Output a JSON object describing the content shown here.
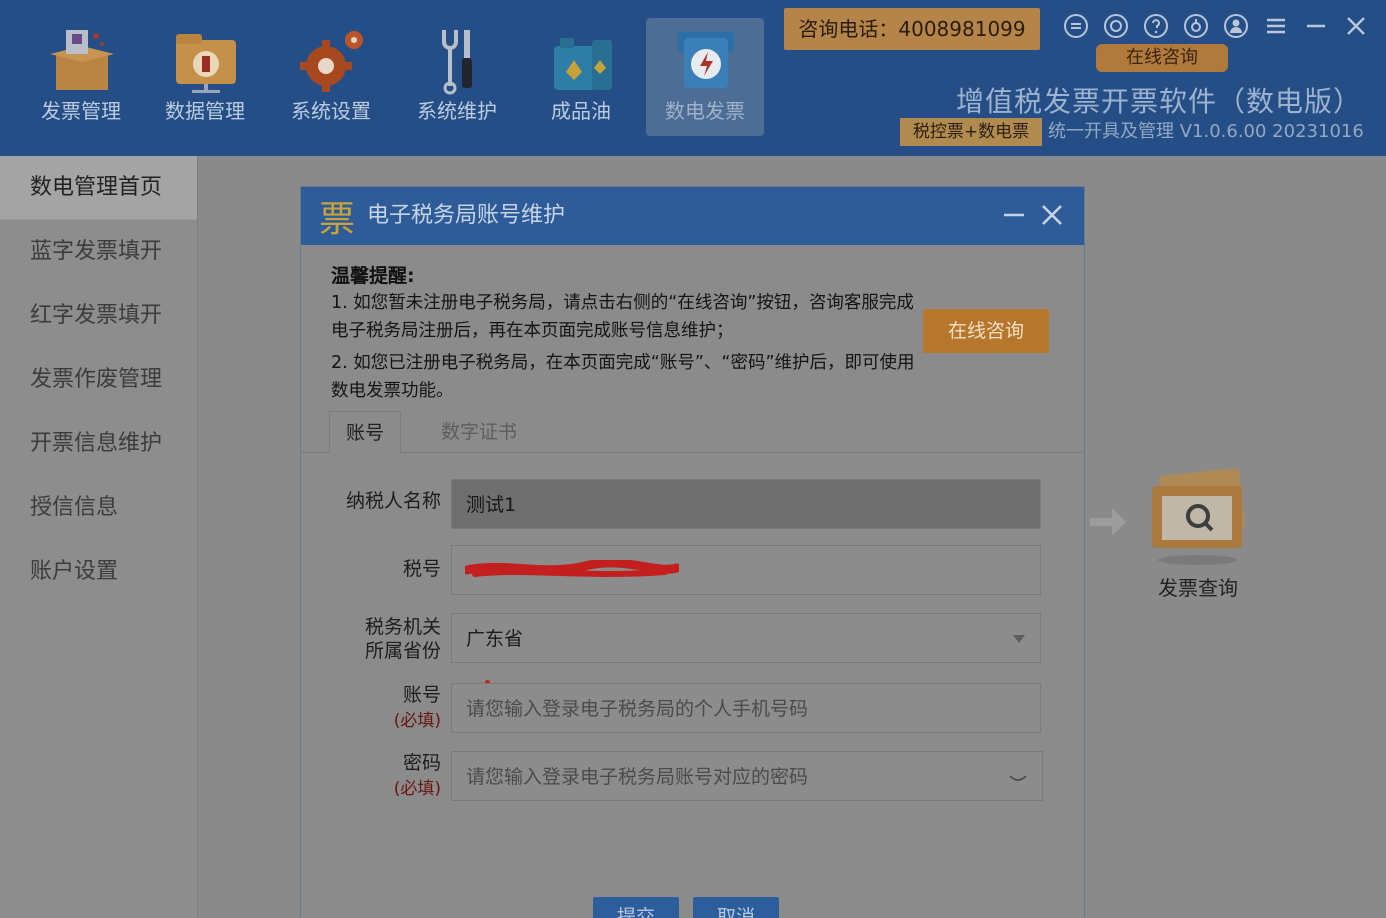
{
  "nav": [
    {
      "label": "发票管理",
      "icon": "invoice-box-icon"
    },
    {
      "label": "数据管理",
      "icon": "data-folder-icon"
    },
    {
      "label": "系统设置",
      "icon": "gear-icon"
    },
    {
      "label": "系统维护",
      "icon": "wrench-screwdriver-icon"
    },
    {
      "label": "成品油",
      "icon": "oil-can-icon"
    },
    {
      "label": "数电发票",
      "icon": "digital-invoice-icon"
    }
  ],
  "header": {
    "hotline": "咨询电话：4008981099",
    "consult_top": "在线咨询",
    "app_title": "增值税发票开票软件（数电版）",
    "tax_badge": "税控票+数电票",
    "version": "统一开具及管理 V1.0.6.00 20231016"
  },
  "sidebar": {
    "items": [
      "数电管理首页",
      "蓝字发票填开",
      "红字发票填开",
      "发票作废管理",
      "开票信息维护",
      "授信信息",
      "账户设置"
    ]
  },
  "background": {
    "invoice_query": "发票查询"
  },
  "dialog": {
    "title": "电子税务局账号维护",
    "tips_title": "温馨提醒:",
    "tip1": "1. 如您暂未注册电子税务局，请点击右侧的“在线咨询”按钮，咨询客服完成电子税务局注册后，再在本页面完成账号信息维护；",
    "tip2": "2. 如您已注册电子税务局，在本页面完成“账号”、“密码”维护后，即可使用数电发票功能。",
    "consult_btn": "在线咨询",
    "tabs": [
      "账号",
      "数字证书"
    ],
    "fields": {
      "taxpayer_label": "纳税人名称",
      "taxpayer_value": "测试1",
      "taxid_label": "税号",
      "province_label1": "税务机关",
      "province_label2": "所属省份",
      "province_value": "广东省",
      "account_label": "账号",
      "required": "(必填)",
      "account_placeholder": "请您输入登录电子税务局的个人手机号码",
      "password_label": "密码",
      "password_placeholder": "请您输入登录电子税务局账号对应的密码"
    },
    "submit": "提交",
    "cancel": "取消"
  },
  "colors": {
    "header_bg": "#244e85",
    "accent_orange": "#b6762b",
    "dialog_title_bg": "#2e5c98"
  }
}
